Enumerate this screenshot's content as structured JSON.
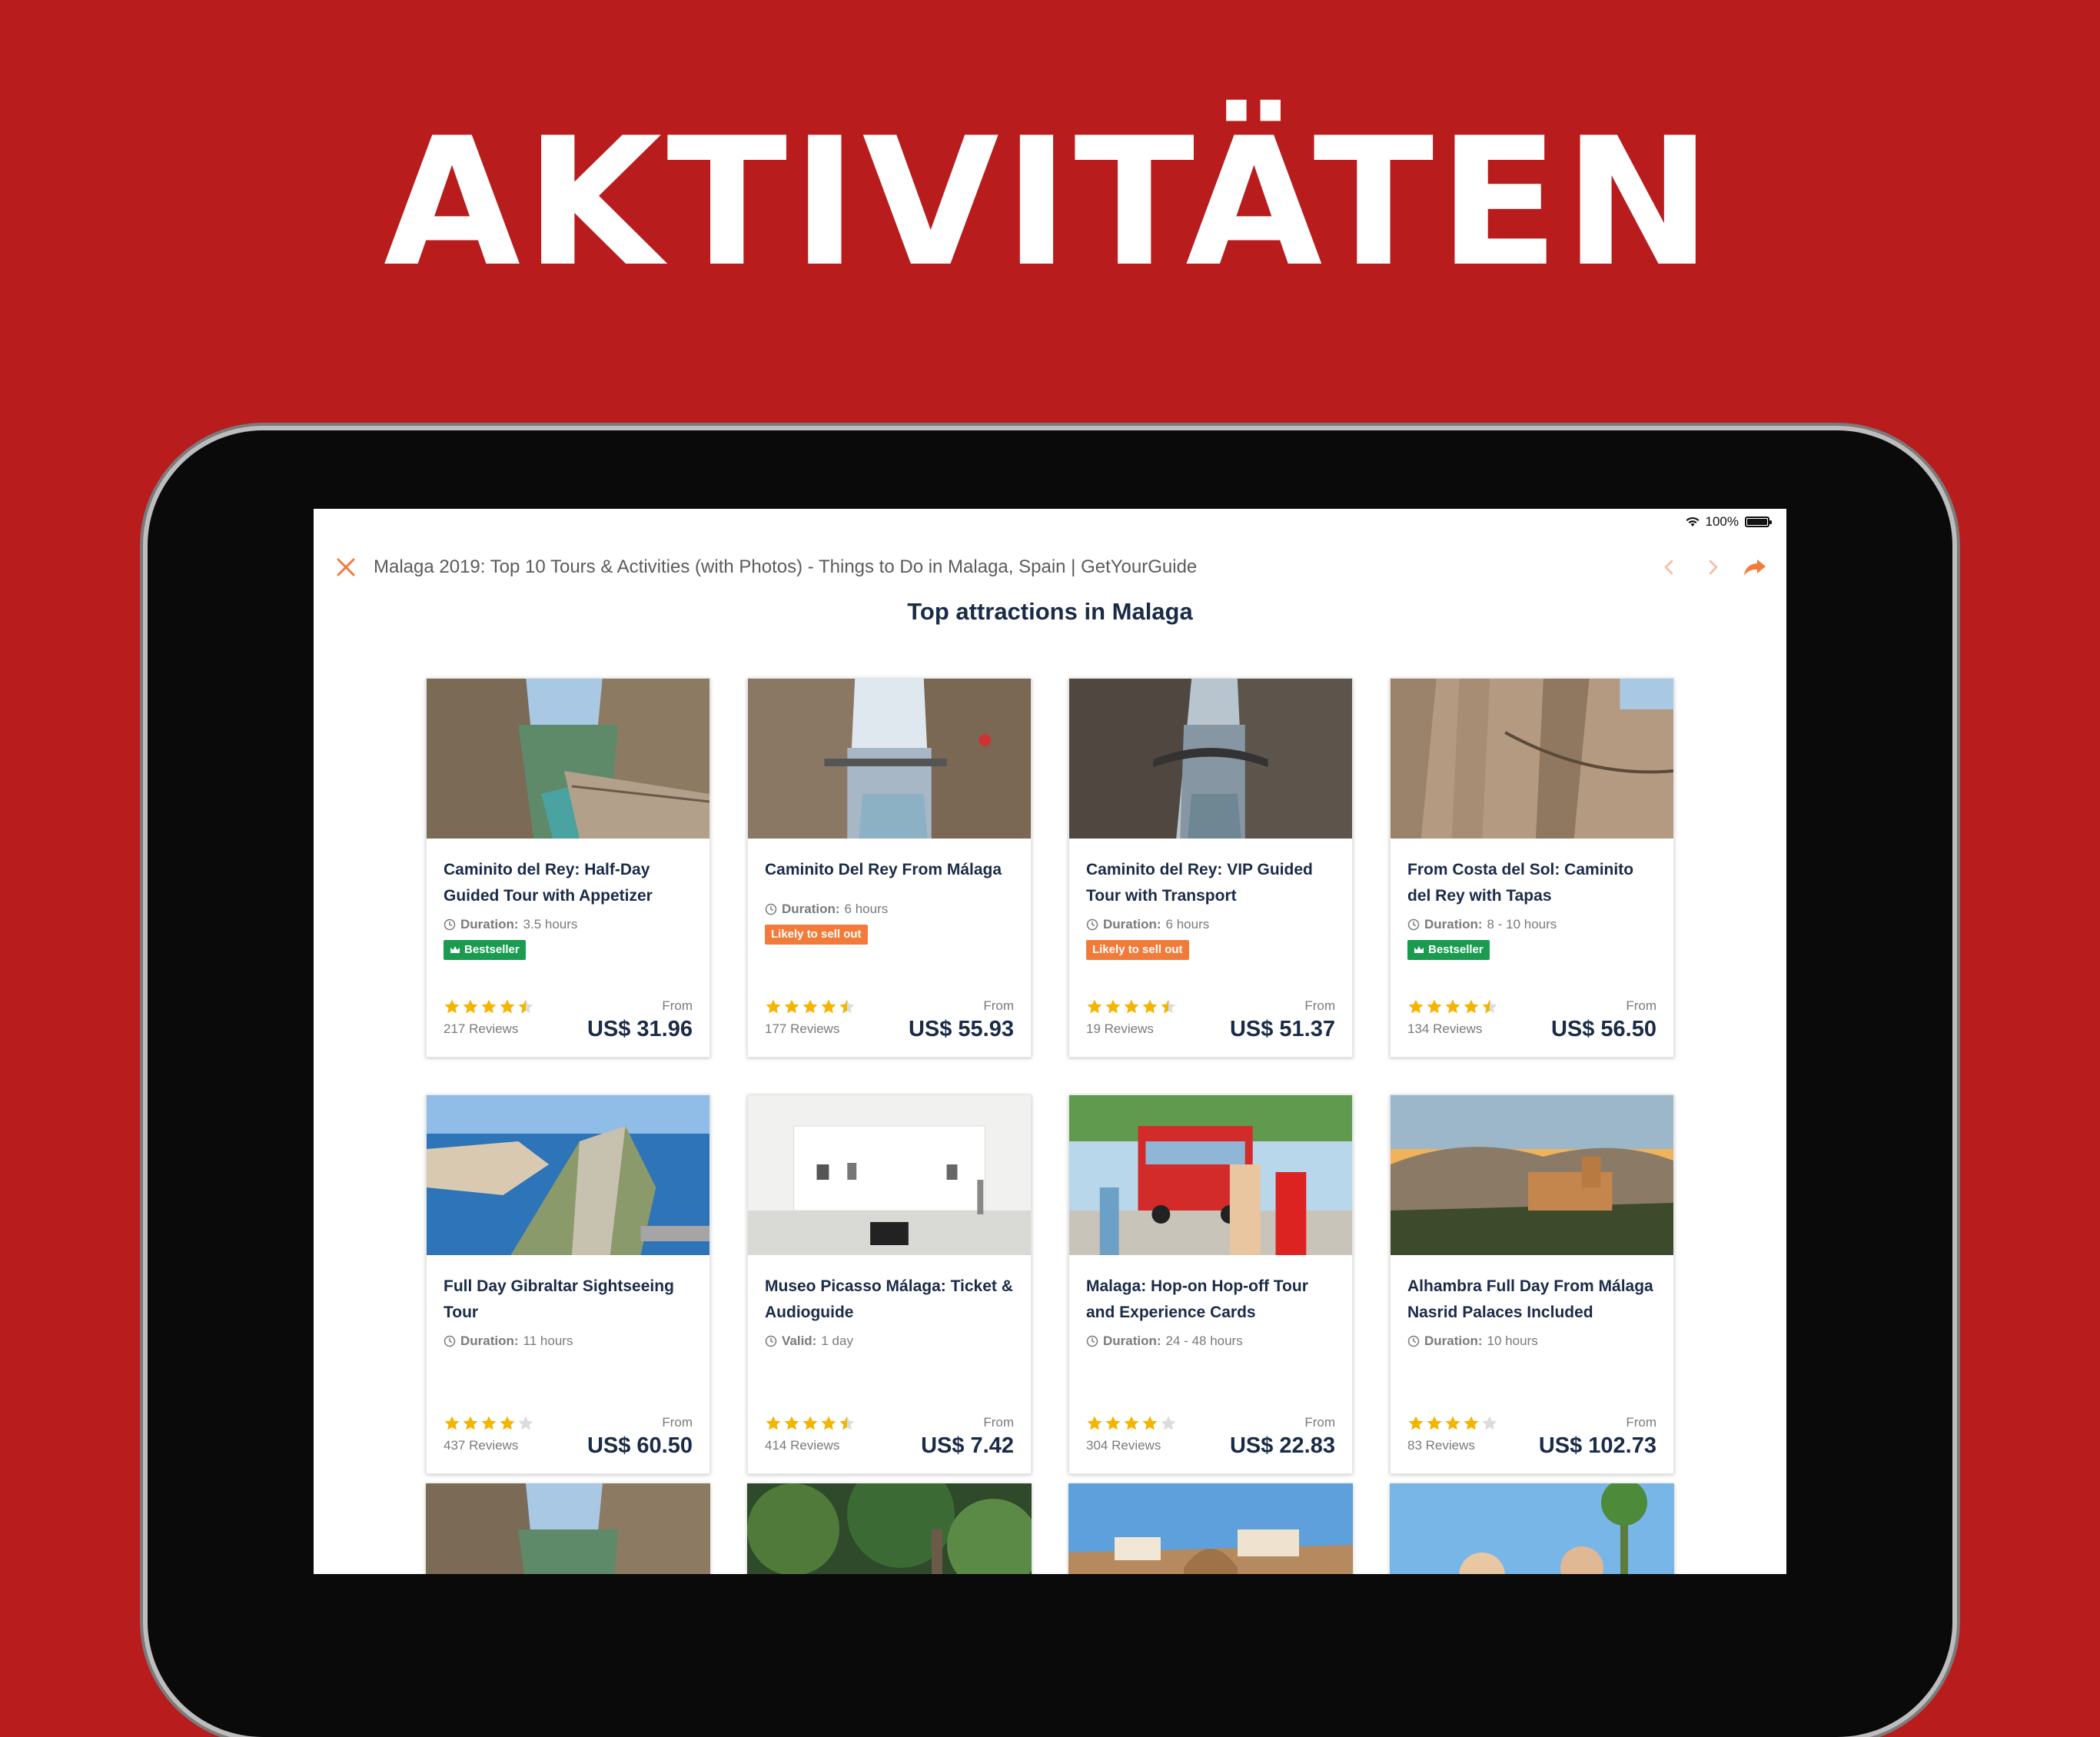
{
  "headline": "AKTIVITÄTEN",
  "status": {
    "battery": "100%",
    "battery_level": 1.0
  },
  "browser": {
    "title": "Malaga 2019: Top 10 Tours & Activities (with Photos) - Things to Do in Malaga, Spain | GetYourGuide"
  },
  "section_title": "Top attractions in Malaga",
  "colors": {
    "background": "#b81c1c",
    "accent": "#f37b3a",
    "navy": "#1a2b48",
    "star": "#f5b400",
    "bestseller": "#1a9b50"
  },
  "cards": [
    {
      "title": "Caminito del Rey: Half-Day Guided Tour with Appetizer",
      "duration_label": "Duration:",
      "duration": "3.5 hours",
      "badge": "Bestseller",
      "badge_type": "green",
      "rating": 4.5,
      "reviews": "217 Reviews",
      "from": "From",
      "price": "US$ 31.96",
      "image": "gorge-walkway"
    },
    {
      "title": "Caminito Del Rey From Málaga",
      "duration_label": "Duration:",
      "duration": "6 hours",
      "badge": "Likely to sell out",
      "badge_type": "orange",
      "rating": 4.5,
      "reviews": "177 Reviews",
      "from": "From",
      "price": "US$ 55.93",
      "image": "gorge-bridge"
    },
    {
      "title": "Caminito del Rey: VIP Guided Tour with Transport",
      "duration_label": "Duration:",
      "duration": "6 hours",
      "badge": "Likely to sell out",
      "badge_type": "orange",
      "rating": 4.5,
      "reviews": "19 Reviews",
      "from": "From",
      "price": "US$ 51.37",
      "image": "gorge-bridge-dark"
    },
    {
      "title": "From Costa del Sol: Caminito del Rey with Tapas",
      "duration_label": "Duration:",
      "duration": "8 - 10 hours",
      "badge": "Bestseller",
      "badge_type": "green",
      "rating": 4.5,
      "reviews": "134 Reviews",
      "from": "From",
      "price": "US$ 56.50",
      "image": "cliff-walkway"
    },
    {
      "title": "Full Day Gibraltar Sightseeing Tour",
      "duration_label": "Duration:",
      "duration": "11 hours",
      "badge": "",
      "badge_type": "",
      "rating": 4,
      "reviews": "437 Reviews",
      "from": "From",
      "price": "US$ 60.50",
      "image": "gibraltar"
    },
    {
      "title": "Museo Picasso Málaga: Ticket & Audioguide",
      "duration_label": "Valid:",
      "duration": "1 day",
      "badge": "",
      "badge_type": "",
      "rating": 4.5,
      "reviews": "414 Reviews",
      "from": "From",
      "price": "US$ 7.42",
      "image": "museum"
    },
    {
      "title": "Malaga: Hop-on Hop-off Tour and Experience Cards",
      "duration_label": "Duration:",
      "duration": "24 - 48 hours",
      "badge": "",
      "badge_type": "",
      "rating": 4,
      "reviews": "304 Reviews",
      "from": "From",
      "price": "US$ 22.83",
      "image": "bus"
    },
    {
      "title": "Alhambra Full Day From Málaga Nasrid Palaces Included",
      "duration_label": "Duration:",
      "duration": "10 hours",
      "badge": "",
      "badge_type": "",
      "rating": 4,
      "reviews": "83 Reviews",
      "from": "From",
      "price": "US$ 102.73",
      "image": "alhambra"
    }
  ],
  "partial_cards": [
    {
      "image": "gorge-walkway"
    },
    {
      "image": "garden"
    },
    {
      "image": "ronda"
    },
    {
      "image": "festival"
    }
  ]
}
